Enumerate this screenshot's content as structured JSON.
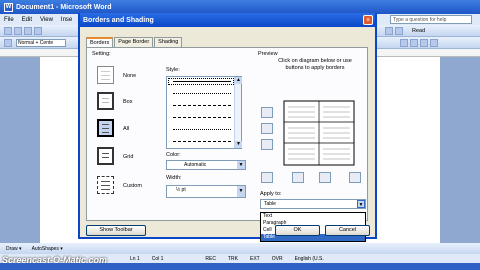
{
  "window": {
    "title": "Document1 - Microsoft Word",
    "menu": [
      "File",
      "Edit",
      "View",
      "Inse"
    ],
    "help_placeholder": "Type a question for help",
    "style_box": "Normal + Cente",
    "read_label": "Read"
  },
  "dialog": {
    "title": "Borders and Shading",
    "close": "×",
    "tabs": [
      "Borders",
      "Page Border",
      "Shading"
    ],
    "setting_label": "Setting:",
    "settings": [
      "None",
      "Box",
      "All",
      "Grid",
      "Custom"
    ],
    "style_label": "Style:",
    "color_label": "Color:",
    "color_value": "Automatic",
    "width_label": "Width:",
    "width_value": "½ pt",
    "preview_label": "Preview",
    "preview_hint": "Click on diagram below or use buttons to apply borders",
    "apply_label": "Apply to:",
    "apply_value": "Table",
    "apply_options": [
      "Text",
      "Paragraph",
      "Cell",
      "Table"
    ],
    "show_toolbar": "Show Toolbar",
    "ok": "OK",
    "cancel": "Cancel"
  },
  "drawing": {
    "draw_label": "Draw ▾",
    "autoshapes_label": "AutoShapes ▾"
  },
  "status": {
    "ln": "Ln 1",
    "col": "Col 1",
    "rec": "REC",
    "trk": "TRK",
    "ext": "EXT",
    "ovr": "OVR",
    "lang": "English (U.S."
  },
  "watermark": "Screencast-O-Matic.com",
  "colors": {
    "title_blue": "#0a46c8",
    "selected_blue": "#316ac5",
    "close_red": "#e35a2a"
  }
}
